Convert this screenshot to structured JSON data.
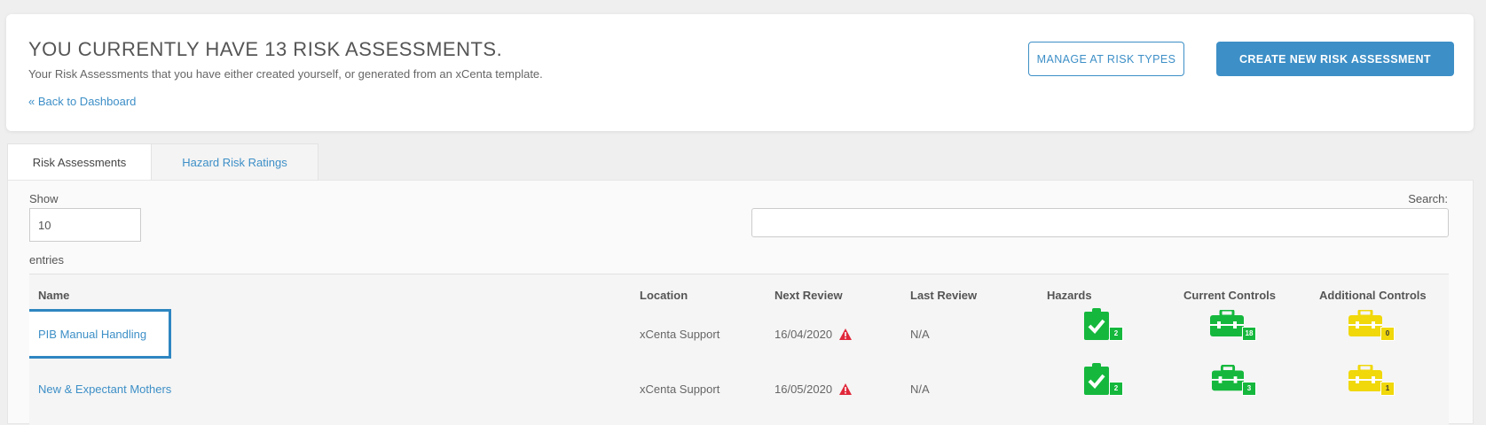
{
  "header": {
    "title": "YOU CURRENTLY HAVE 13 RISK ASSESSMENTS.",
    "subtitle": "Your Risk Assessments that you have either created yourself, or generated from an xCenta template.",
    "back_link": "« Back to Dashboard",
    "manage_button": "MANAGE AT RISK TYPES",
    "create_button": "CREATE NEW RISK ASSESSMENT"
  },
  "tabs": [
    {
      "label": "Risk Assessments",
      "active": true
    },
    {
      "label": "Hazard Risk Ratings",
      "active": false
    }
  ],
  "table_controls": {
    "show_label": "Show",
    "page_length": "10",
    "entries_label": "entries",
    "search_label": "Search:",
    "search_value": ""
  },
  "table": {
    "columns": [
      "Name",
      "Location",
      "Next Review",
      "Last Review",
      "Hazards",
      "Current Controls",
      "Additional Controls"
    ],
    "rows": [
      {
        "name": "PIB Manual Handling",
        "location": "xCenta Support",
        "next_review": "16/04/2020",
        "last_review": "N/A",
        "hazards": "2",
        "current_controls": "18",
        "additional_controls": "0"
      },
      {
        "name": "New & Expectant Mothers",
        "location": "xCenta Support",
        "next_review": "16/05/2020",
        "last_review": "N/A",
        "hazards": "2",
        "current_controls": "3",
        "additional_controls": "1"
      }
    ]
  },
  "colors": {
    "accent": "#3d8fc7",
    "green": "#15b83d",
    "yellow": "#f0d80a",
    "warning": "#e0283a"
  },
  "icons": {
    "hazards": "clipboard-check-icon",
    "current_controls": "toolbox-icon",
    "additional_controls": "toolbox-icon",
    "next_review_warning": "warning-triangle-icon"
  }
}
